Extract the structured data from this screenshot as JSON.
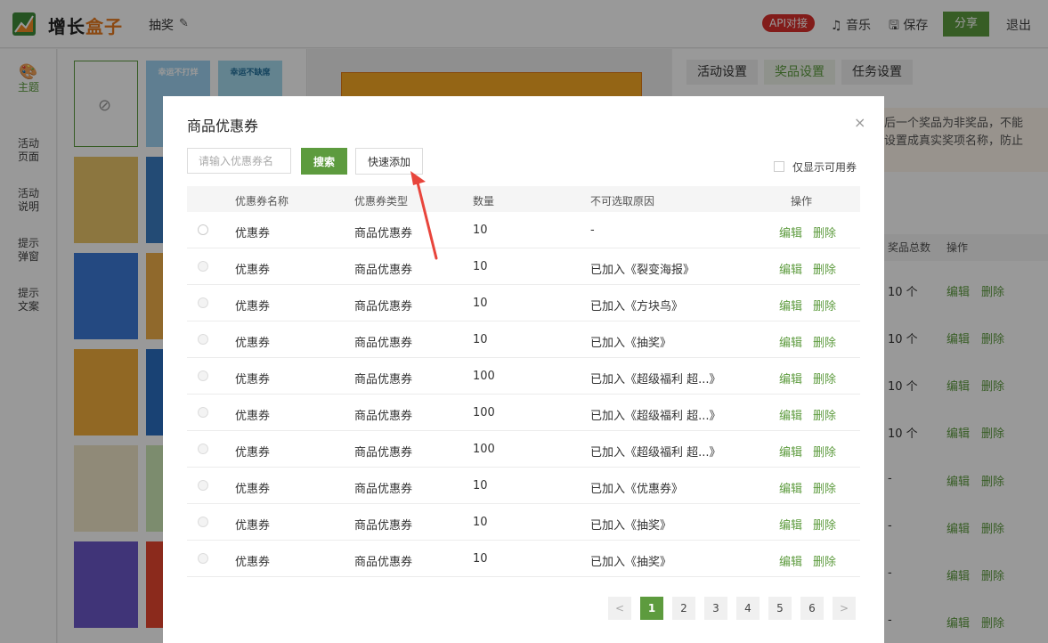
{
  "header": {
    "brand_part1": "增长",
    "brand_part2": "盒子",
    "project_name": "抽奖",
    "api_badge": "API对接",
    "music_label": "音乐",
    "save_label": "保存",
    "share_label": "分享",
    "logout_label": "退出",
    "accent_color": "#5d9b3e",
    "badge_color": "#d9302c"
  },
  "leftnav": {
    "items": [
      {
        "label": "主题",
        "active": true
      },
      {
        "label_line1": "活动",
        "label_line2": "页面"
      },
      {
        "label_line1": "活动",
        "label_line2": "说明"
      },
      {
        "label_line1": "提示",
        "label_line2": "弹窗"
      },
      {
        "label_line1": "提示",
        "label_line2": "文案"
      }
    ]
  },
  "templates": {
    "t1_text": "幸运不打烊",
    "t2_text": "幸运不缺席"
  },
  "right": {
    "tabs": [
      "活动设置",
      "奖品设置",
      "任务设置"
    ],
    "active_tab": "奖品设置",
    "notice_line1": "后一个奖品为非奖品，不能",
    "notice_line2": "设置成真实奖项名称，防止",
    "col_total": "奖品总数",
    "col_action": "操作",
    "rows": [
      {
        "total": "10 个"
      },
      {
        "total": "10 个"
      },
      {
        "total": "10 个"
      },
      {
        "total": "10 个"
      },
      {
        "total": "-"
      },
      {
        "total": "-"
      },
      {
        "total": "-"
      },
      {
        "total": "-"
      }
    ],
    "edit": "编辑",
    "delete": "删除"
  },
  "modal": {
    "title": "商品优惠券",
    "close_icon": "×",
    "search_placeholder": "请输入优惠券名",
    "search_button": "搜索",
    "quick_add_button": "快速添加",
    "only_available_label": "仅显示可用券",
    "columns": [
      "优惠券名称",
      "优惠券类型",
      "数量",
      "不可选取原因",
      "操作"
    ],
    "rows": [
      {
        "name": "优惠券",
        "type": "商品优惠券",
        "qty": "10",
        "reason": "-",
        "selectable": true
      },
      {
        "name": "优惠券",
        "type": "商品优惠券",
        "qty": "10",
        "reason": "已加入《裂变海报》",
        "selectable": false
      },
      {
        "name": "优惠券",
        "type": "商品优惠券",
        "qty": "10",
        "reason": "已加入《方块鸟》",
        "selectable": false
      },
      {
        "name": "优惠券",
        "type": "商品优惠券",
        "qty": "10",
        "reason": "已加入《抽奖》",
        "selectable": false
      },
      {
        "name": "优惠券",
        "type": "商品优惠券",
        "qty": "100",
        "reason": "已加入《超级福利 超...》",
        "selectable": false
      },
      {
        "name": "优惠券",
        "type": "商品优惠券",
        "qty": "100",
        "reason": "已加入《超级福利 超...》",
        "selectable": false
      },
      {
        "name": "优惠券",
        "type": "商品优惠券",
        "qty": "100",
        "reason": "已加入《超级福利 超...》",
        "selectable": false
      },
      {
        "name": "优惠券",
        "type": "商品优惠券",
        "qty": "10",
        "reason": "已加入《优惠券》",
        "selectable": false
      },
      {
        "name": "优惠券",
        "type": "商品优惠券",
        "qty": "10",
        "reason": "已加入《抽奖》",
        "selectable": false
      },
      {
        "name": "优惠券",
        "type": "商品优惠券",
        "qty": "10",
        "reason": "已加入《抽奖》",
        "selectable": false
      }
    ],
    "edit": "编辑",
    "delete": "删除",
    "pagination": {
      "prev": "<",
      "next": ">",
      "pages": [
        "1",
        "2",
        "3",
        "4",
        "5",
        "6"
      ],
      "current": "1"
    }
  }
}
